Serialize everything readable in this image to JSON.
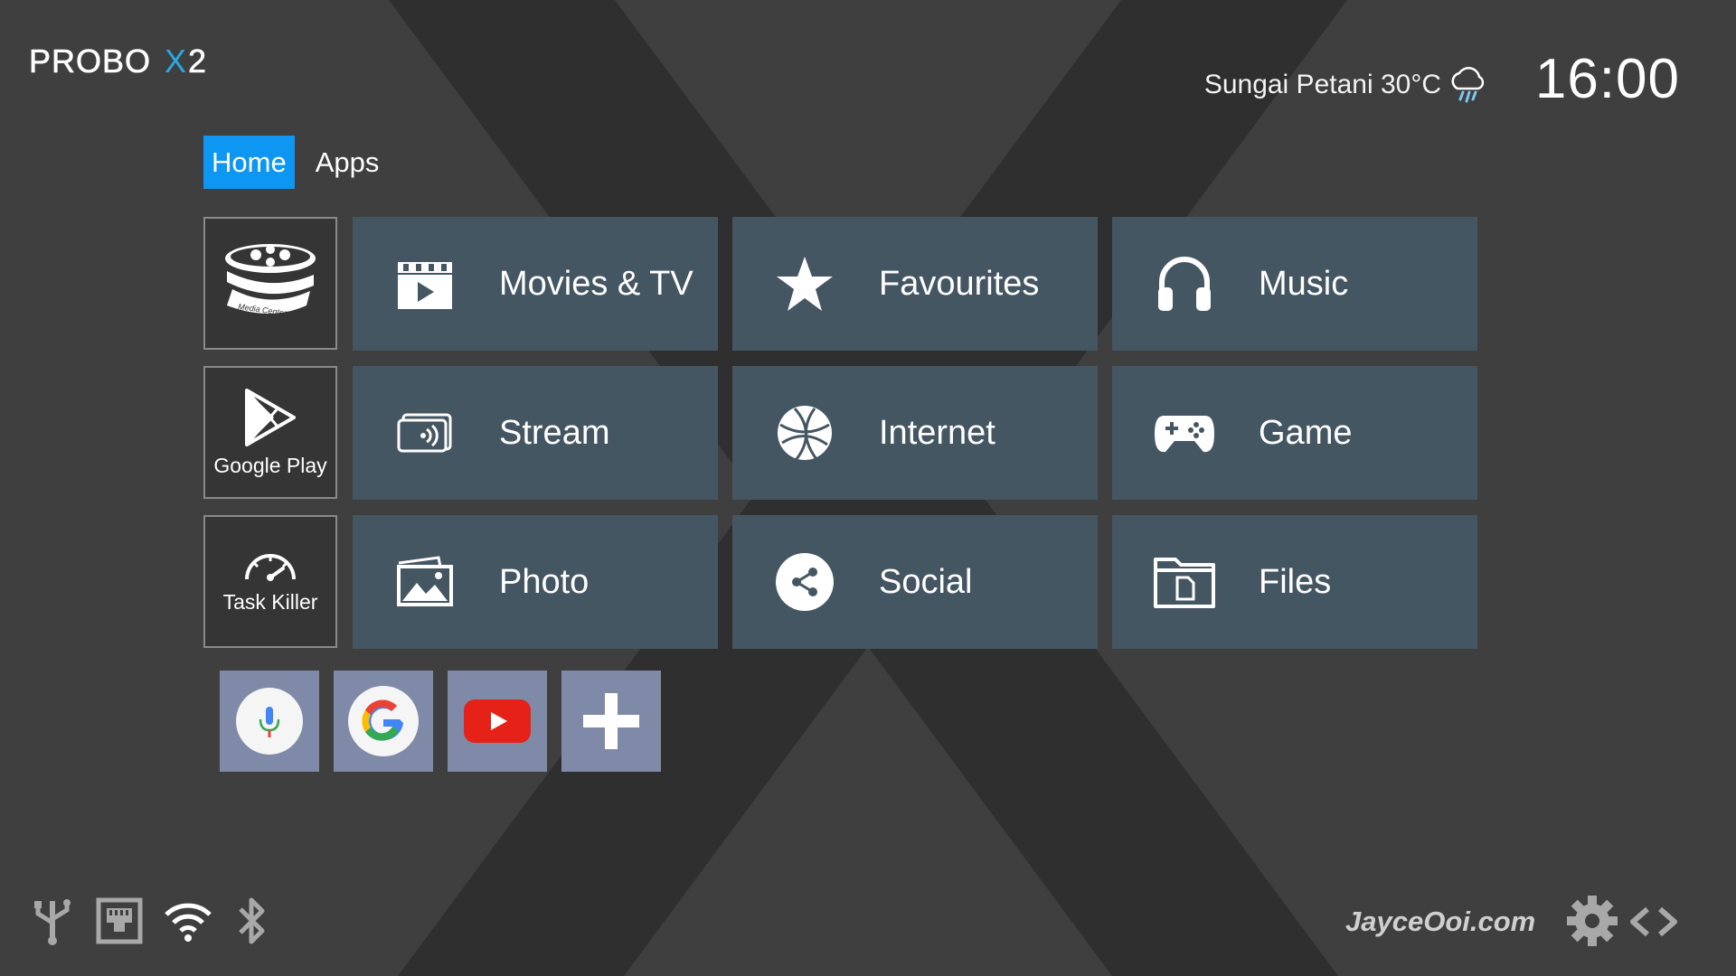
{
  "brand": {
    "logo_text": "PROBOX2"
  },
  "weather": {
    "location_temp": "Sungai Petani 30°C",
    "icon": "rain-cloud-icon"
  },
  "clock": "16:00",
  "tabs": [
    {
      "label": "Home",
      "active": true
    },
    {
      "label": "Apps",
      "active": false
    }
  ],
  "side_tiles": [
    {
      "label": "",
      "icon": "media-center-icon",
      "logo_text": "Media Center"
    },
    {
      "label": "Google Play",
      "icon": "play-store-icon"
    },
    {
      "label": "Task Killer",
      "icon": "speedometer-icon"
    }
  ],
  "tiles": [
    {
      "label": "Movies & TV",
      "icon": "clapperboard-icon"
    },
    {
      "label": "Favourites",
      "icon": "star-icon"
    },
    {
      "label": "Music",
      "icon": "headphones-icon"
    },
    {
      "label": "Stream",
      "icon": "cast-icon"
    },
    {
      "label": "Internet",
      "icon": "globe-icon"
    },
    {
      "label": "Game",
      "icon": "gamepad-icon"
    },
    {
      "label": "Photo",
      "icon": "photos-icon"
    },
    {
      "label": "Social",
      "icon": "share-icon"
    },
    {
      "label": "Files",
      "icon": "folder-file-icon"
    }
  ],
  "quick_buttons": [
    {
      "icon": "microphone-icon"
    },
    {
      "icon": "google-icon"
    },
    {
      "icon": "youtube-icon"
    },
    {
      "icon": "add-icon"
    }
  ],
  "status_icons": [
    "usb-icon",
    "ethernet-icon",
    "wifi-icon",
    "bluetooth-icon"
  ],
  "watermark": "JayceOoi.com",
  "colors": {
    "accent": "#0d96f2",
    "tile": "#455663",
    "quick": "#7e8aa8",
    "background": "#3f3f3f"
  }
}
